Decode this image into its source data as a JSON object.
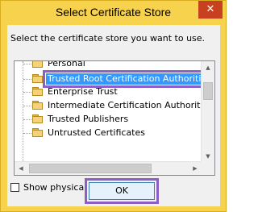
{
  "window": {
    "title": "Select Certificate Store",
    "close_glyph": "✕",
    "accent_color": "#f7d24c",
    "close_color": "#c7401f"
  },
  "instruction": "Select the certificate store you want to use.",
  "tree": {
    "items": [
      {
        "label": "Personal",
        "selected": false
      },
      {
        "label": "Trusted Root Certification Authorities",
        "selected": true
      },
      {
        "label": "Enterprise Trust",
        "selected": false
      },
      {
        "label": "Intermediate Certification Authorities",
        "selected": false
      },
      {
        "label": "Trusted Publishers",
        "selected": false
      },
      {
        "label": "Untrusted Certificates",
        "selected": false
      }
    ],
    "selection_color": "#3399ff",
    "highlight_color": "#8a5fc8"
  },
  "checkbox": {
    "label": "Show physical stores",
    "checked": false
  },
  "buttons": {
    "ok_label": "OK"
  }
}
